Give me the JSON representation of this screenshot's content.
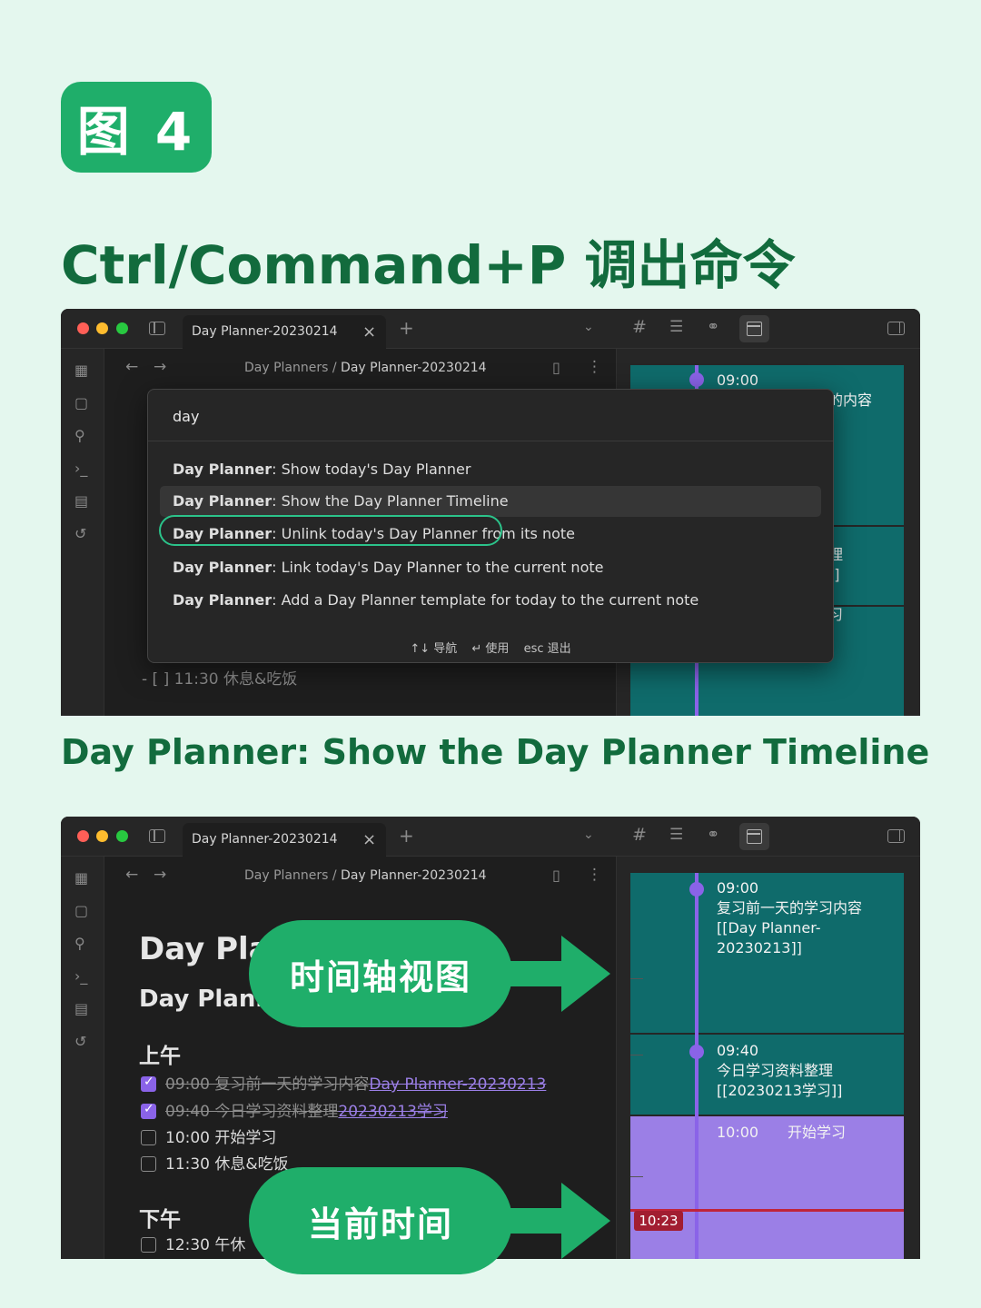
{
  "badge": "图 4",
  "headline": "Ctrl/Command+P 调出命令",
  "subtitle": "Day Planner: Show the Day Planner Timeline",
  "colors": {
    "accent_green": "#1fae6a",
    "heading_green": "#126b3d",
    "timeline_teal": "#0f6b6b",
    "timeline_purple": "#9b7fe6",
    "now_red": "#c0243a"
  },
  "window": {
    "tab_title": "Day Planner-20230214",
    "close_icon": "×",
    "plus_icon": "+",
    "icons": [
      "sidebar-toggle-icon",
      "chevron-down-icon",
      "tag-icon",
      "list-icon",
      "link-icon",
      "calendar-icon",
      "right-sidebar-icon"
    ],
    "breadcrumb": {
      "folder": "Day Planners",
      "sep": "/",
      "file": "Day Planner-20230214"
    }
  },
  "palette": {
    "query": "day",
    "items": [
      {
        "bold": "Day Planner",
        "rest": ": Show today's Day Planner"
      },
      {
        "bold": "Day Planner",
        "rest": ": Show the Day Planner Timeline"
      },
      {
        "bold": "Day Planner",
        "rest": ": Unlink today's Day Planner from its note"
      },
      {
        "bold": "Day Planner",
        "rest": ": Link today's Day Planner to the current note"
      },
      {
        "bold": "Day Planner",
        "rest": ": Add a Day Planner template for today to the current note"
      }
    ],
    "footer": {
      "nav": "↑↓ 导航",
      "use": "↵ 使用",
      "exit": "esc 退出"
    }
  },
  "window1_bg": {
    "task_line": "- [  ] 11:30 休息&吃饭",
    "timeline_time": "09:00",
    "timeline_fragments": [
      "的内容",
      "理",
      "]]",
      "习"
    ]
  },
  "window2": {
    "h1": "Day Plan",
    "h2": "Day Plann",
    "morning": "上午",
    "afternoon": "下午",
    "tasks_morning": [
      {
        "text": "09:00 复习前一天的学习内容",
        "link": "Day Planner-20230213",
        "done": true
      },
      {
        "text": "09:40 今日学习资料整理",
        "link": "20230213学习",
        "done": true
      },
      {
        "text": "10:00 开始学习",
        "link": "",
        "done": false
      },
      {
        "text": "11:30 休息&吃饭",
        "link": "",
        "done": false
      }
    ],
    "tasks_afternoon": [
      {
        "text": "12:30 午休",
        "link": "",
        "done": false
      }
    ],
    "timeline": {
      "blocks": [
        {
          "time": "09:00",
          "lines": [
            "复习前一天的学习内容",
            "[[Day Planner-",
            "20230213]]"
          ]
        },
        {
          "time": "09:40",
          "lines": [
            "今日学习资料整理",
            "[[20230213学习]]"
          ]
        },
        {
          "time": "10:00",
          "lines": [
            "开始学习"
          ]
        }
      ],
      "now": "10:23"
    }
  },
  "callouts": {
    "timeline_view": "时间轴视图",
    "current_time": "当前时间"
  }
}
